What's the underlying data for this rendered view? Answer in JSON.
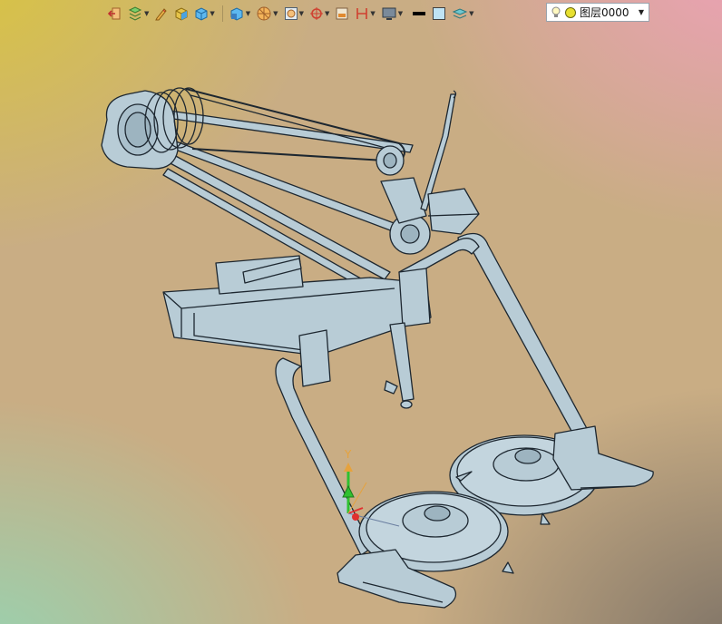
{
  "toolbar": {
    "items": [
      {
        "name": "exit-edit-icon",
        "has_dropdown": false
      },
      {
        "name": "layer-visibility-icon",
        "has_dropdown": true
      },
      {
        "name": "pencil-edit-icon",
        "has_dropdown": false
      },
      {
        "name": "solid-box-icon",
        "has_dropdown": false
      },
      {
        "name": "shaded-cube-icon",
        "has_dropdown": true
      },
      {
        "name": "view-orientation-icon",
        "has_dropdown": true
      },
      {
        "name": "render-style-icon",
        "has_dropdown": true
      },
      {
        "name": "view-frame-icon",
        "has_dropdown": true
      },
      {
        "name": "snap-target-icon",
        "has_dropdown": true
      },
      {
        "name": "section-view-icon",
        "has_dropdown": false
      },
      {
        "name": "measure-icon",
        "has_dropdown": true
      },
      {
        "name": "display-monitor-icon",
        "has_dropdown": true
      },
      {
        "name": "line-color-icon",
        "has_dropdown": false
      },
      {
        "name": "fill-color-icon",
        "has_dropdown": false
      },
      {
        "name": "layer-stack-icon",
        "has_dropdown": true
      }
    ],
    "layer_select": {
      "value": "图层0000",
      "icons": [
        "lightbulb-icon",
        "yellow-dot-icon"
      ]
    }
  },
  "colors": {
    "model_fill": "#b8ccd6",
    "model_stroke": "#1d2730",
    "axis_y": "#2fc12f",
    "axis_x": "#e03030",
    "axis_label": "#e6a23c"
  },
  "triad": {
    "axis_label": "Y"
  }
}
